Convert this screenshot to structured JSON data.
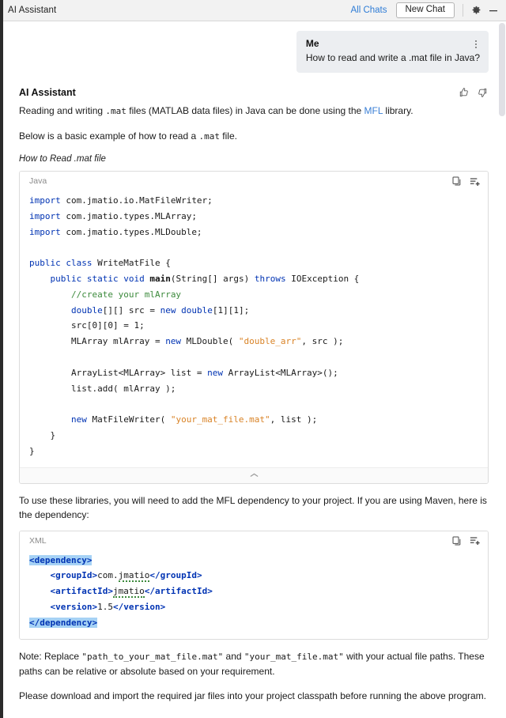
{
  "titlebar": {
    "title": "AI Assistant",
    "all_chats_label": "All Chats",
    "new_chat_label": "New Chat",
    "settings_icon": "gear-icon",
    "minimize_icon": "minimize-icon"
  },
  "user_message": {
    "author": "Me",
    "text": "How to read and write a .mat file in Java?",
    "menu_icon": "kebab-menu-icon"
  },
  "assistant_message": {
    "author": "AI Assistant",
    "thumbs_up_icon": "thumbs-up-icon",
    "thumbs_down_icon": "thumbs-down-icon",
    "para1_prefix": "Reading and writing ",
    "para1_mono": ".mat",
    "para1_mid": " files (MATLAB data files) in Java can be done using the ",
    "para1_link": "MFL",
    "para1_suffix": " library.",
    "para2_prefix": "Below is a basic example of how to read a ",
    "para2_mono": ".mat",
    "para2_suffix": " file.",
    "subhead": "How to Read .mat file",
    "para3": "To use these libraries, you will need to add the MFL dependency to your project. If you are using Maven, here is the dependency:",
    "note_prefix": "Note: Replace ",
    "note_path1": "\"path_to_your_mat_file.mat\"",
    "note_mid": " and ",
    "note_path2": "\"your_mat_file.mat\"",
    "note_suffix": " with your actual file paths. These paths can be relative or absolute based on your requirement.",
    "final_note": "Please download and import the required jar files into your project classpath before running the above program."
  },
  "code_block_java": {
    "language": "Java",
    "copy_icon": "copy-icon",
    "insert_icon": "insert-into-editor-icon",
    "collapse_icon": "chevron-up-icon",
    "lines": [
      "import com.jmatio.io.MatFileWriter;",
      "import com.jmatio.types.MLArray;",
      "import com.jmatio.types.MLDouble;",
      "",
      "public class WriteMatFile {",
      "    public static void main(String[] args) throws IOException {",
      "        //create your mlArray",
      "        double[][] src = new double[1][1];",
      "        src[0][0] = 1;",
      "        MLArray mlArray = new MLDouble( \"double_arr\", src );",
      "",
      "        ArrayList<MLArray> list = new ArrayList<MLArray>();",
      "        list.add( mlArray );",
      "",
      "        new MatFileWriter( \"your_mat_file.mat\", list );",
      "    }",
      "}"
    ]
  },
  "code_block_xml": {
    "language": "XML",
    "copy_icon": "copy-icon",
    "insert_icon": "insert-into-editor-icon",
    "lines": [
      "<dependency>",
      "    <groupId>com.jmatio</groupId>",
      "    <artifactId>jmatio</artifactId>",
      "    <version>1.5</version>",
      "</dependency>"
    ],
    "selected_lines": [
      "<dependency>",
      "</dependency>"
    ],
    "spellcheck_words": [
      "jmatio"
    ]
  },
  "colors": {
    "accent_link": "#2e7cd6",
    "keyword": "#0033b3",
    "comment": "#3c8a3c",
    "string": "#d98326",
    "selection": "#a6d2f5",
    "user_bubble": "#eceef1",
    "titlebar_bg": "#f2f2f2"
  }
}
